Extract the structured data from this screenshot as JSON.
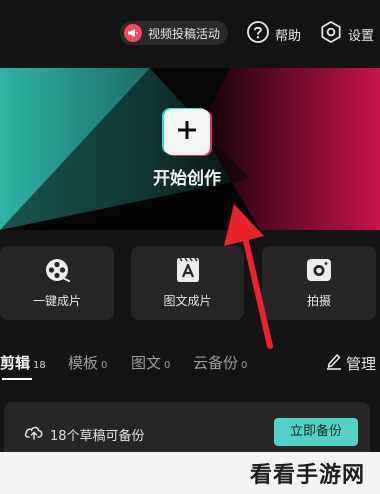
{
  "topbar": {
    "promo_label": "视频投稿活动",
    "help_label": "帮助",
    "settings_label": "设置"
  },
  "hero": {
    "create_label": "开始创作"
  },
  "quick_actions": [
    {
      "label": "一键成片",
      "icon": "film-reel-icon"
    },
    {
      "label": "图文成片",
      "icon": "text-to-video-icon"
    },
    {
      "label": "拍摄",
      "icon": "camera-icon"
    }
  ],
  "tabs": [
    {
      "label": "剪辑",
      "count": "18"
    },
    {
      "label": "模板",
      "count": "0"
    },
    {
      "label": "图文",
      "count": "0"
    },
    {
      "label": "云备份",
      "count": "0"
    }
  ],
  "manage_label": "管理",
  "backup": {
    "message": "18个草稿可备份",
    "button_label": "立即备份"
  },
  "watermark": "看看手游网",
  "colors": {
    "accent_teal": "#53d1c4",
    "accent_red": "#e5336a",
    "background": "#141414",
    "card": "#262626",
    "arrow_red": "#e8232b"
  }
}
